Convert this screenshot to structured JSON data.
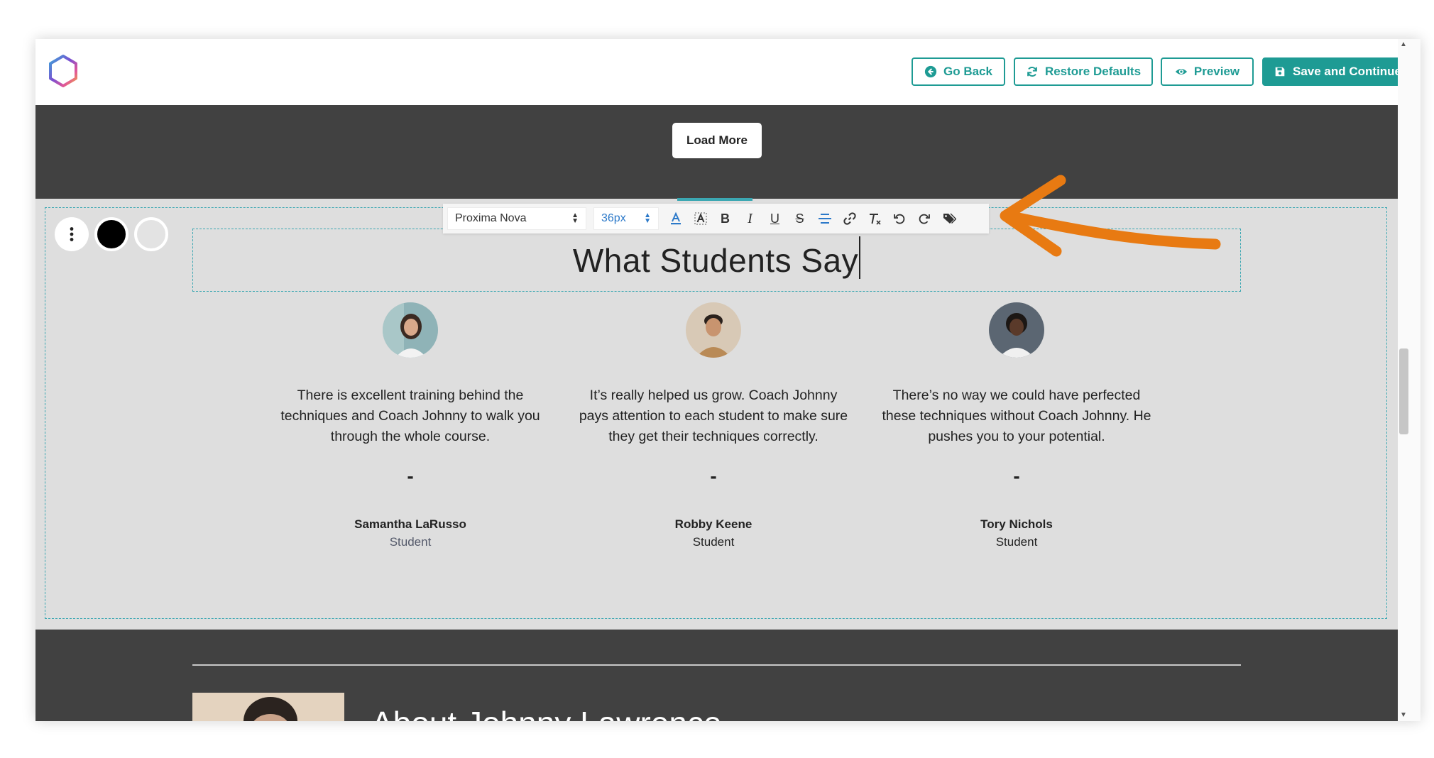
{
  "toolbar": {
    "go_back": "Go Back",
    "restore_defaults": "Restore Defaults",
    "preview": "Preview",
    "save_continue": "Save and Continue",
    "accent_color": "#1e9b94"
  },
  "load_more": "Load More",
  "editor": {
    "font_family": "Proxima Nova",
    "font_size": "36px",
    "buttons": [
      "text-color-icon",
      "highlight-icon",
      "bold-icon",
      "italic-icon",
      "underline-icon",
      "strikethrough-icon",
      "align-icon",
      "link-icon",
      "clear-format-icon",
      "undo-icon",
      "redo-icon",
      "tag-icon"
    ]
  },
  "section_controls": {
    "swatch_dark": "#000000",
    "swatch_light": "#e3e3e3"
  },
  "testimonials": {
    "heading": "What Students Say",
    "items": [
      {
        "quote": "There is excellent training behind the techniques and Coach Johnny to walk you through the whole course.",
        "dash": "-",
        "name": "Samantha LaRusso",
        "role": "Student"
      },
      {
        "quote": "It’s really helped us grow. Coach Johnny pays attention to each student to make sure they get their techniques correctly.",
        "dash": "-",
        "name": "Robby Keene",
        "role": "Student"
      },
      {
        "quote": "There’s no way we could have perfected these techniques without Coach Johnny. He pushes you to your potential.",
        "dash": "-",
        "name": "Tory Nichols",
        "role": "Student"
      }
    ]
  },
  "about": {
    "heading": "About Johnny Lawrence"
  },
  "annotation": {
    "color": "#e87a12"
  }
}
